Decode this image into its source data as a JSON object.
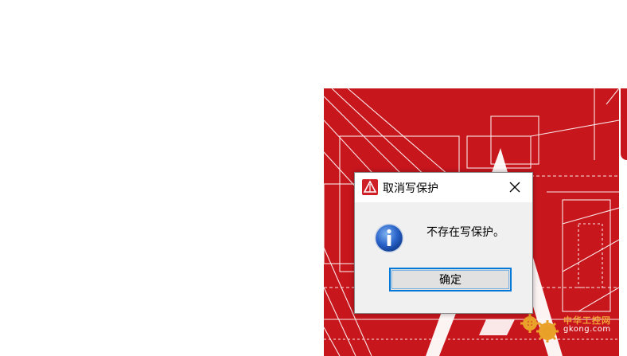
{
  "dialog": {
    "title": "取消写保护",
    "message": "不存在写保护。",
    "ok_label": "确定"
  },
  "watermark": {
    "cn_text": "中华工控网",
    "url_text": "gkong.com"
  },
  "colors": {
    "splash_red": "#c8161d",
    "accent_blue": "#0078d7",
    "dialog_bg": "#f0f0f0"
  },
  "icons": {
    "title": "app-logo-icon",
    "close": "close-icon",
    "info": "info-icon"
  }
}
